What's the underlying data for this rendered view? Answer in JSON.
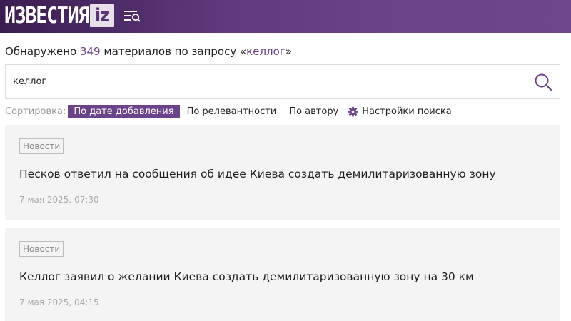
{
  "header": {
    "logo_text": "ИЗВЕСТИЯ",
    "logo_badge": "iz",
    "menu_icon": "menu-search-icon"
  },
  "summary": {
    "prefix": "Обнаружено ",
    "count": "349",
    "middle": " материалов по запросу «",
    "query": "келлог",
    "suffix": "»"
  },
  "search": {
    "value": "келлог",
    "icon": "search-icon"
  },
  "sort": {
    "label": "Сортировка:",
    "options": [
      {
        "label": "По дате добавления",
        "active": true
      },
      {
        "label": "По релевантности",
        "active": false
      },
      {
        "label": "По автору",
        "active": false
      }
    ],
    "settings_label": "Настройки поиска",
    "settings_icon": "gear-icon"
  },
  "results": [
    {
      "category": "Новости",
      "title": "Песков ответил на сообщения об идее Киева создать демилитаризованную зону",
      "date": "7 мая 2025, 07:30"
    },
    {
      "category": "Новости",
      "title": "Келлог заявил о желании Киева создать демилитаризованную зону на 30 км",
      "date": "7 мая 2025, 04:15"
    }
  ],
  "colors": {
    "brand": "#6b4389",
    "header_dark": "#3a1d50",
    "card_bg": "#f4f4f4"
  }
}
